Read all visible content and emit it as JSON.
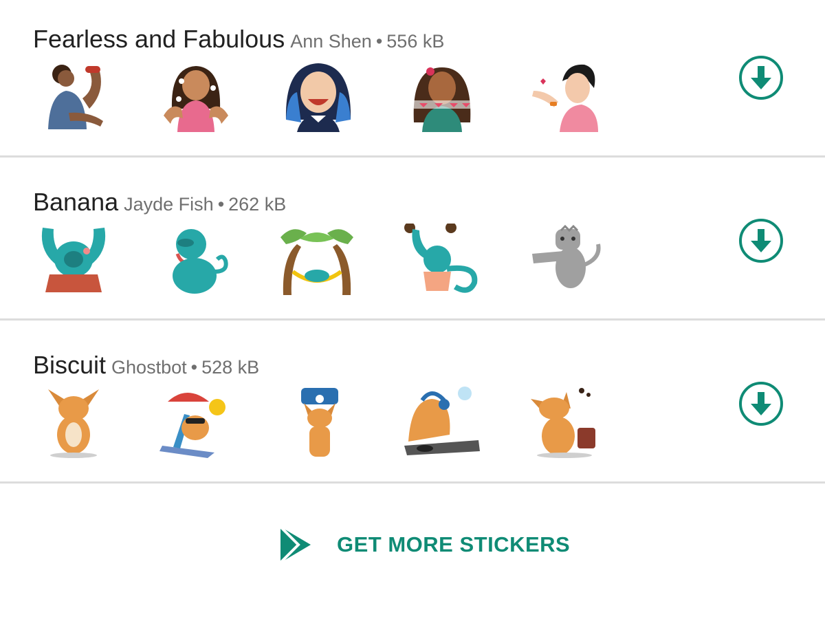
{
  "colors": {
    "accent": "#0f8b75",
    "title": "#212121",
    "meta": "#6f6f6f",
    "divider": "#dcdcdc"
  },
  "packs": [
    {
      "title": "Fearless and Fabulous",
      "author": "Ann Shen",
      "separator": "•",
      "size": "556 kB",
      "download_icon": "download-circle-icon"
    },
    {
      "title": "Banana",
      "author": "Jayde Fish",
      "separator": "•",
      "size": "262 kB",
      "download_icon": "download-circle-icon"
    },
    {
      "title": "Biscuit",
      "author": "Ghostbot",
      "separator": "•",
      "size": "528 kB",
      "download_icon": "download-circle-icon"
    }
  ],
  "get_more": {
    "label": "GET MORE STICKERS",
    "icon": "play-store-icon"
  }
}
